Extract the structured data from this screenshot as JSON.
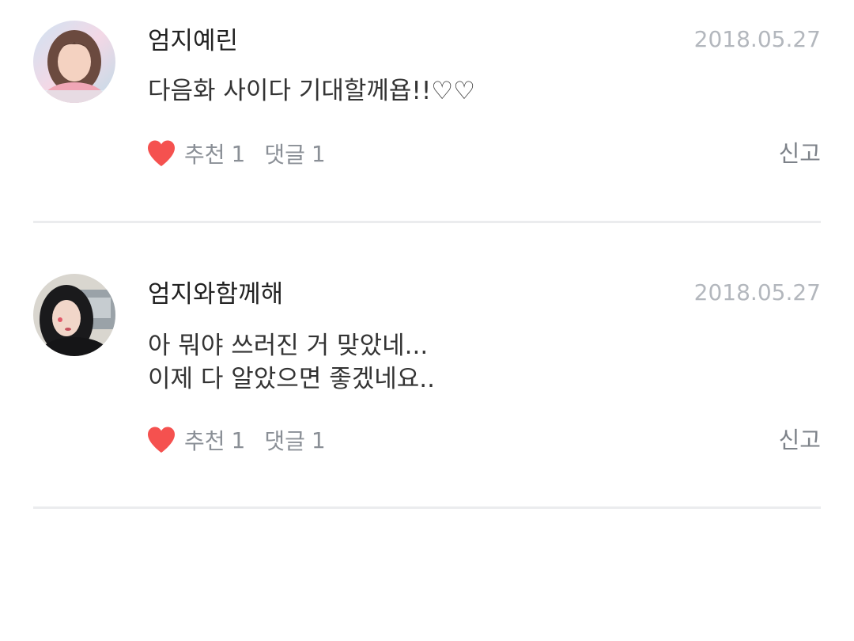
{
  "comments": [
    {
      "author": "엄지예린",
      "date": "2018.05.27",
      "lines": [
        "다음화 사이다 기대할께욥!!♡♡"
      ],
      "like_label": "추천",
      "like_count": "1",
      "reply_label": "댓글",
      "reply_count": "1",
      "report_label": "신고",
      "avatar_icon": "profile-photo"
    },
    {
      "author": "엄지와함께해",
      "date": "2018.05.27",
      "lines": [
        "아 뭐야 쓰러진 거 맞았네...",
        "이제 다 알았으면 좋겠네요.."
      ],
      "like_label": "추천",
      "like_count": "1",
      "reply_label": "댓글",
      "reply_count": "1",
      "report_label": "신고",
      "avatar_icon": "profile-photo"
    }
  ],
  "colors": {
    "heart": "#f5514f",
    "date": "#b3b7bd",
    "meta": "#8a8f96",
    "divider": "#ebecee"
  }
}
